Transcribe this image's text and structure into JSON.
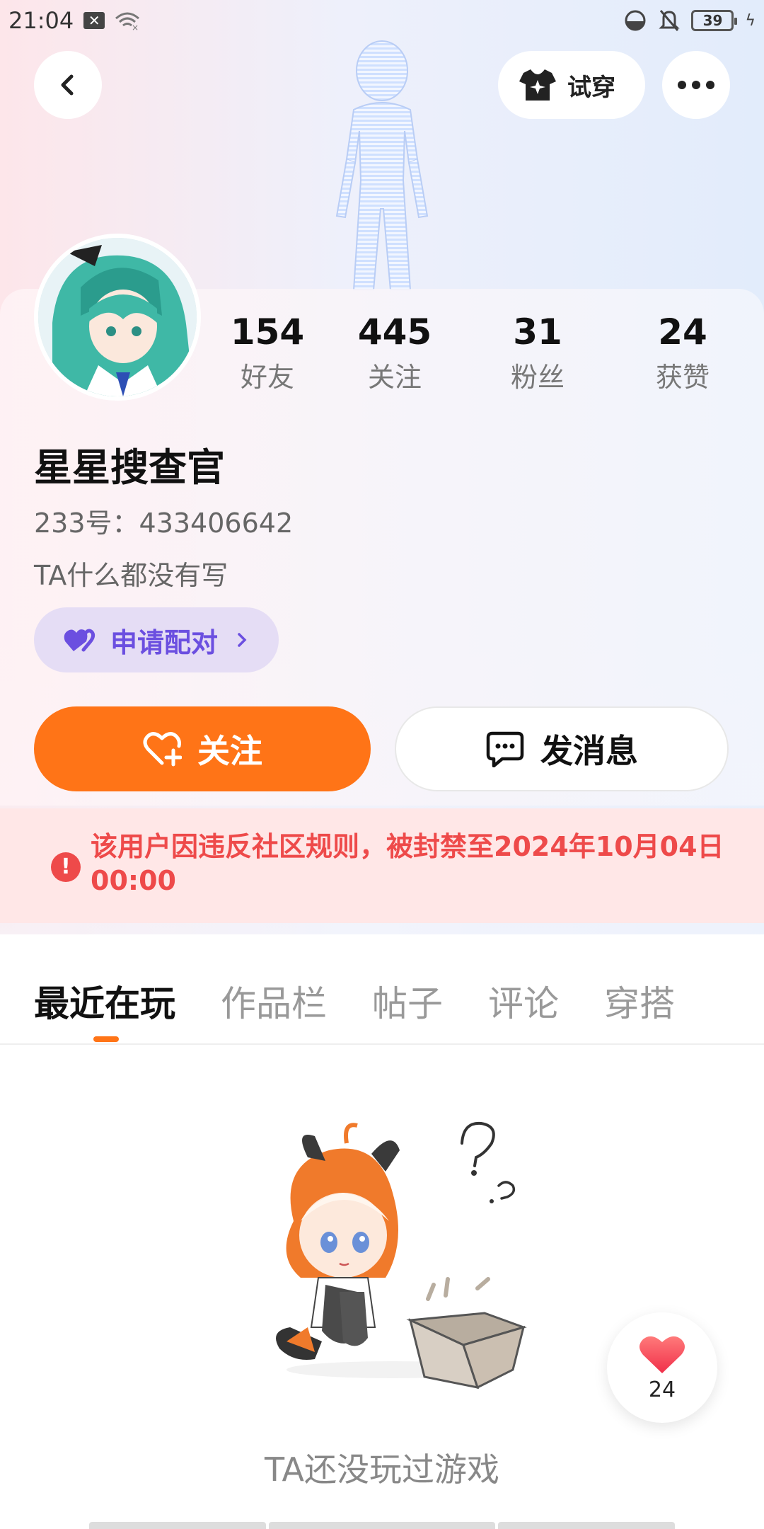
{
  "status_bar": {
    "time": "21:04",
    "battery": "39"
  },
  "header": {
    "tryon_label": "试穿"
  },
  "profile": {
    "stats": [
      {
        "value": "154",
        "label": "好友"
      },
      {
        "value": "445",
        "label": "关注"
      },
      {
        "value": "31",
        "label": "粉丝"
      },
      {
        "value": "24",
        "label": "获赞"
      }
    ],
    "name": "星星搜查官",
    "uid": "233号：433406642",
    "bio": "TA什么都没有写",
    "pair_label": "申请配对"
  },
  "actions": {
    "follow_label": "关注",
    "message_label": "发消息"
  },
  "ban_notice": "该用户因违反社区规则，被封禁至2024年10月04日 00:00",
  "tabs": [
    {
      "label": "最近在玩",
      "active": true
    },
    {
      "label": "作品栏",
      "active": false
    },
    {
      "label": "帖子",
      "active": false
    },
    {
      "label": "评论",
      "active": false
    },
    {
      "label": "穿搭",
      "active": false
    }
  ],
  "empty_state": {
    "text": "TA还没玩过游戏"
  },
  "like_fab": {
    "count": "24"
  },
  "colors": {
    "accent": "#ff7417",
    "pair_purple": "#6b4fe0",
    "ban_red": "#ee4a4a"
  }
}
